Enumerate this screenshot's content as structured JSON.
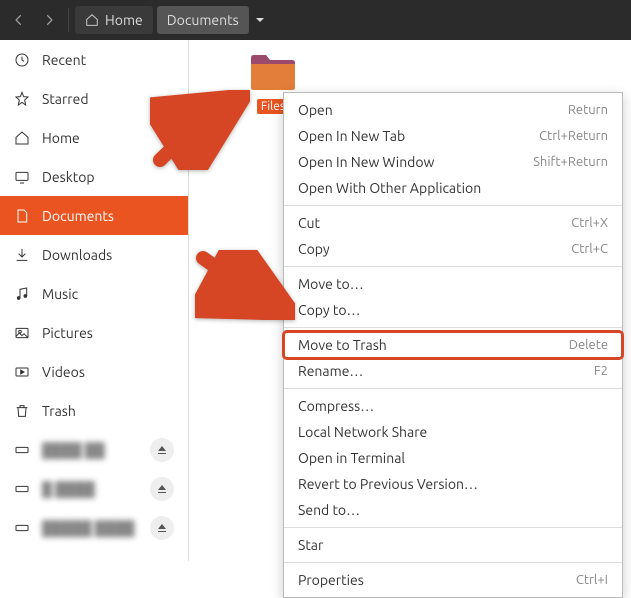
{
  "titlebar": {
    "home_label": "Home",
    "crumb_label": "Documents"
  },
  "sidebar": {
    "items": [
      {
        "label": "Recent"
      },
      {
        "label": "Starred"
      },
      {
        "label": "Home"
      },
      {
        "label": "Desktop"
      },
      {
        "label": "Documents"
      },
      {
        "label": "Downloads"
      },
      {
        "label": "Music"
      },
      {
        "label": "Pictures"
      },
      {
        "label": "Videos"
      },
      {
        "label": "Trash"
      }
    ]
  },
  "folder": {
    "name": "Files"
  },
  "context_menu": {
    "items": [
      {
        "label": "Open",
        "shortcut": "Return"
      },
      {
        "label": "Open In New Tab",
        "shortcut": "Ctrl+Return"
      },
      {
        "label": "Open In New Window",
        "shortcut": "Shift+Return"
      },
      {
        "label": "Open With Other Application",
        "shortcut": ""
      },
      {
        "label": "Cut",
        "shortcut": "Ctrl+X"
      },
      {
        "label": "Copy",
        "shortcut": "Ctrl+C"
      },
      {
        "label": "Move to…",
        "shortcut": ""
      },
      {
        "label": "Copy to…",
        "shortcut": ""
      },
      {
        "label": "Move to Trash",
        "shortcut": "Delete"
      },
      {
        "label": "Rename…",
        "shortcut": "F2"
      },
      {
        "label": "Compress…",
        "shortcut": ""
      },
      {
        "label": "Local Network Share",
        "shortcut": ""
      },
      {
        "label": "Open in Terminal",
        "shortcut": ""
      },
      {
        "label": "Revert to Previous Version…",
        "shortcut": ""
      },
      {
        "label": "Send to…",
        "shortcut": ""
      },
      {
        "label": "Star",
        "shortcut": ""
      },
      {
        "label": "Properties",
        "shortcut": "Ctrl+I"
      }
    ],
    "highlight_index": 8
  },
  "colors": {
    "accent": "#e95420",
    "arrow": "#d64524"
  }
}
